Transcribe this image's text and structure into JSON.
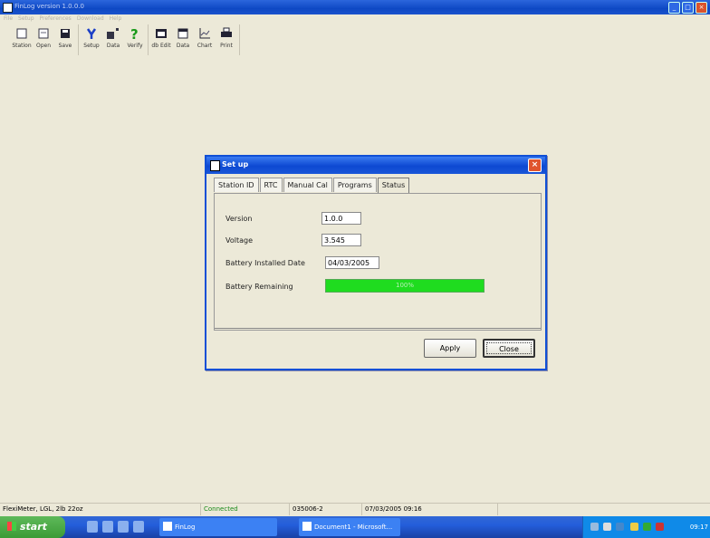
{
  "window": {
    "title": "FinLog version 1.0.0.0"
  },
  "menu": [
    "File",
    "Setup",
    "Preferences",
    "Download",
    "Help"
  ],
  "toolbar": [
    {
      "label": "Station",
      "icon": "station-icon"
    },
    {
      "label": "Open",
      "icon": "open-icon"
    },
    {
      "label": "Save",
      "icon": "save-icon"
    },
    {
      "label": "Setup",
      "icon": "setup-icon"
    },
    {
      "label": "Data",
      "icon": "data-icon"
    },
    {
      "label": "Verify",
      "icon": "verify-icon"
    },
    {
      "label": "db Edit",
      "icon": "db-edit-icon"
    },
    {
      "label": "Data",
      "icon": "data-list-icon"
    },
    {
      "label": "Chart",
      "icon": "chart-icon"
    },
    {
      "label": "Print",
      "icon": "print-icon"
    }
  ],
  "dialog": {
    "title": "Set up",
    "tabs": [
      "Station ID",
      "RTC",
      "Manual Cal",
      "Programs",
      "Status"
    ],
    "active_tab": "Status",
    "fields": {
      "version_label": "Version",
      "version_value": "1.0.0",
      "voltage_label": "Voltage",
      "voltage_value": "3.545",
      "battery_date_label": "Battery Installed Date",
      "battery_date_value": "04/03/2005",
      "battery_remaining_label": "Battery Remaining",
      "battery_remaining_text": "100%",
      "battery_remaining_fraction": 1.0
    },
    "buttons": {
      "apply": "Apply",
      "close": "Close"
    }
  },
  "statusbar": {
    "location": "FlexiMeter, LGL, 2lb 22oz",
    "connection": "Connected",
    "serial": "035006-2",
    "datetime": "07/03/2005 09:16"
  },
  "taskbar": {
    "start": "start",
    "tasks": [
      "FinLog",
      "Document1 - Microsoft..."
    ]
  },
  "colors": {
    "progress": "#1fdc1f",
    "titlebar": "#0e48c4",
    "close": "#e0552e"
  }
}
